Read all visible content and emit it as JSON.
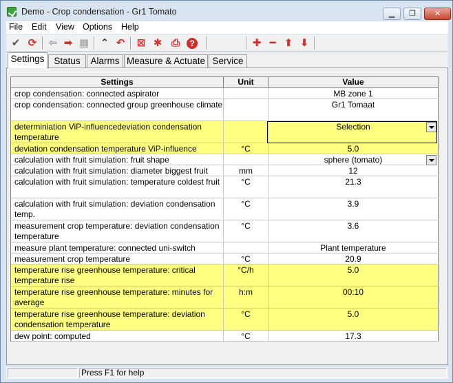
{
  "window": {
    "title": "Demo - Crop condensation - Gr1 Tomato"
  },
  "menu": [
    "File",
    "Edit",
    "View",
    "Options",
    "Help"
  ],
  "toolbar": {
    "buttons": [
      {
        "icon": "check-icon",
        "glyph": "✔",
        "color": "#555555"
      },
      {
        "icon": "refresh-icon",
        "glyph": "⟳",
        "color": "#d0302a"
      },
      {
        "icon": "arrow-left-icon",
        "glyph": "⇦",
        "color": "#9a9a9a"
      },
      {
        "icon": "arrow-right-icon",
        "glyph": "➡",
        "color": "#d0302a"
      },
      {
        "icon": "grid-icon",
        "glyph": "▦",
        "color": "#9a9a9a"
      },
      {
        "icon": "collapse-icon",
        "glyph": "⌃",
        "color": "#333333"
      },
      {
        "icon": "undo-icon",
        "glyph": "↶",
        "color": "#d0302a"
      },
      {
        "icon": "delete-box-icon",
        "glyph": "⊠",
        "color": "#d0302a"
      },
      {
        "icon": "asterisk-icon",
        "glyph": "✱",
        "color": "#d0302a"
      },
      {
        "icon": "print-icon",
        "glyph": "⎙",
        "color": "#d0302a"
      },
      {
        "icon": "help-icon",
        "glyph": "?",
        "color": "#ffffff"
      },
      {
        "icon": "add-icon",
        "glyph": "✚",
        "color": "#d0302a"
      },
      {
        "icon": "remove-icon",
        "glyph": "━",
        "color": "#d0302a"
      },
      {
        "icon": "move-up-icon",
        "glyph": "⬆",
        "color": "#d0302a"
      },
      {
        "icon": "move-down-icon",
        "glyph": "⬇",
        "color": "#d0302a"
      }
    ]
  },
  "tabs": [
    {
      "label": "Settings",
      "active": true
    },
    {
      "label": "Status",
      "active": false
    },
    {
      "label": "Alarms",
      "active": false
    },
    {
      "label": "Measure & Actuate",
      "active": false
    },
    {
      "label": "Service",
      "active": false
    }
  ],
  "table": {
    "headers": {
      "settings": "Settings",
      "unit": "Unit",
      "value": "Value"
    },
    "rows": [
      {
        "setting": "crop condensation: connected aspirator",
        "unit": "",
        "value": "MB zone 1",
        "highlight": false,
        "dropdown": false
      },
      {
        "setting": "crop condensation: connected group greenhouse climate",
        "unit": "",
        "value": "Gr1 Tomaat",
        "highlight": false,
        "dropdown": false
      },
      {
        "setting": "determiniation ViP-influencedeviation condensation temperature",
        "unit": "",
        "value": "Selection",
        "highlight": true,
        "dropdown": true,
        "selected": true
      },
      {
        "setting": "deviation condensation temperature ViP-influence",
        "unit": "°C",
        "value": "5.0",
        "highlight": true,
        "dropdown": false
      },
      {
        "setting": "calculation with fruit simulation: fruit shape",
        "unit": "",
        "value": "sphere (tomato)",
        "highlight": false,
        "dropdown": true
      },
      {
        "setting": "calculation with fruit simulation: diameter biggest fruit",
        "unit": "mm",
        "value": "12",
        "highlight": false,
        "dropdown": false
      },
      {
        "setting": "calculation with fruit simulation: temperature coldest fruit",
        "unit": "°C",
        "value": "21.3",
        "highlight": false,
        "dropdown": false
      },
      {
        "setting": "calculation with fruit simulation: deviation condensation temp.",
        "unit": "°C",
        "value": "3.9",
        "highlight": false,
        "dropdown": false
      },
      {
        "setting": "measurement crop temperature: deviation condensation temperature",
        "unit": "°C",
        "value": "3.6",
        "highlight": false,
        "dropdown": false
      },
      {
        "setting": "measure plant temperature: connected uni-switch",
        "unit": "",
        "value": "Plant temperature",
        "highlight": false,
        "dropdown": false
      },
      {
        "setting": "measurement crop temperature",
        "unit": "°C",
        "value": "20.9",
        "highlight": false,
        "dropdown": false
      },
      {
        "setting": "temperature rise greenhouse temperature: critical temperature rise",
        "unit": "°C/h",
        "value": "5.0",
        "highlight": true,
        "dropdown": false
      },
      {
        "setting": "temperature rise greenhouse temperature: minutes for average",
        "unit": "h:m",
        "value": "00:10",
        "highlight": true,
        "dropdown": false
      },
      {
        "setting": "temperature rise greenhouse temperature: deviation condensation temperature",
        "unit": "°C",
        "value": "5.0",
        "highlight": true,
        "dropdown": false
      },
      {
        "setting": "dew point: computed",
        "unit": "°C",
        "value": "17.3",
        "highlight": false,
        "dropdown": false
      }
    ]
  },
  "status": {
    "help_text": "Press F1 for help"
  },
  "colors": {
    "highlight": "#ffff80",
    "accent_red": "#d0302a"
  }
}
